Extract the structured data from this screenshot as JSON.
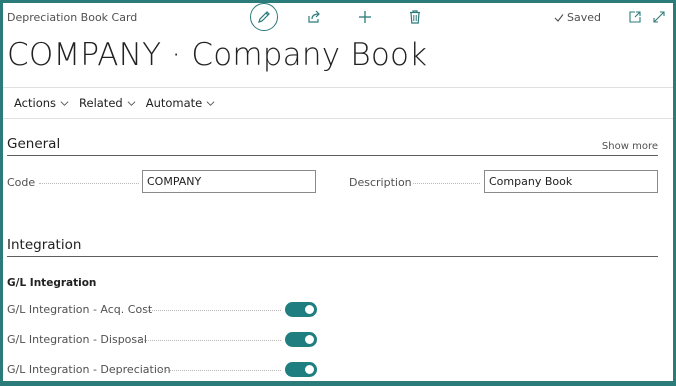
{
  "header": {
    "breadcrumb": "Depreciation Book Card",
    "saved_label": "Saved",
    "title": "COMPANY · Company Book"
  },
  "action_menu": [
    {
      "label": "Actions"
    },
    {
      "label": "Related"
    },
    {
      "label": "Automate"
    }
  ],
  "general": {
    "title": "General",
    "show_more": "Show more",
    "code_label": "Code",
    "code_value": "COMPANY",
    "description_label": "Description",
    "description_value": "Company Book"
  },
  "integration": {
    "title": "Integration",
    "subhead": "G/L Integration",
    "toggles": [
      {
        "label": "G/L Integration - Acq. Cost",
        "on": true
      },
      {
        "label": "G/L Integration - Disposal",
        "on": true
      },
      {
        "label": "G/L Integration - Depreciation",
        "on": true
      }
    ]
  },
  "colors": {
    "accent": "#2b7b7a",
    "toggle_on": "#1f7f80"
  }
}
